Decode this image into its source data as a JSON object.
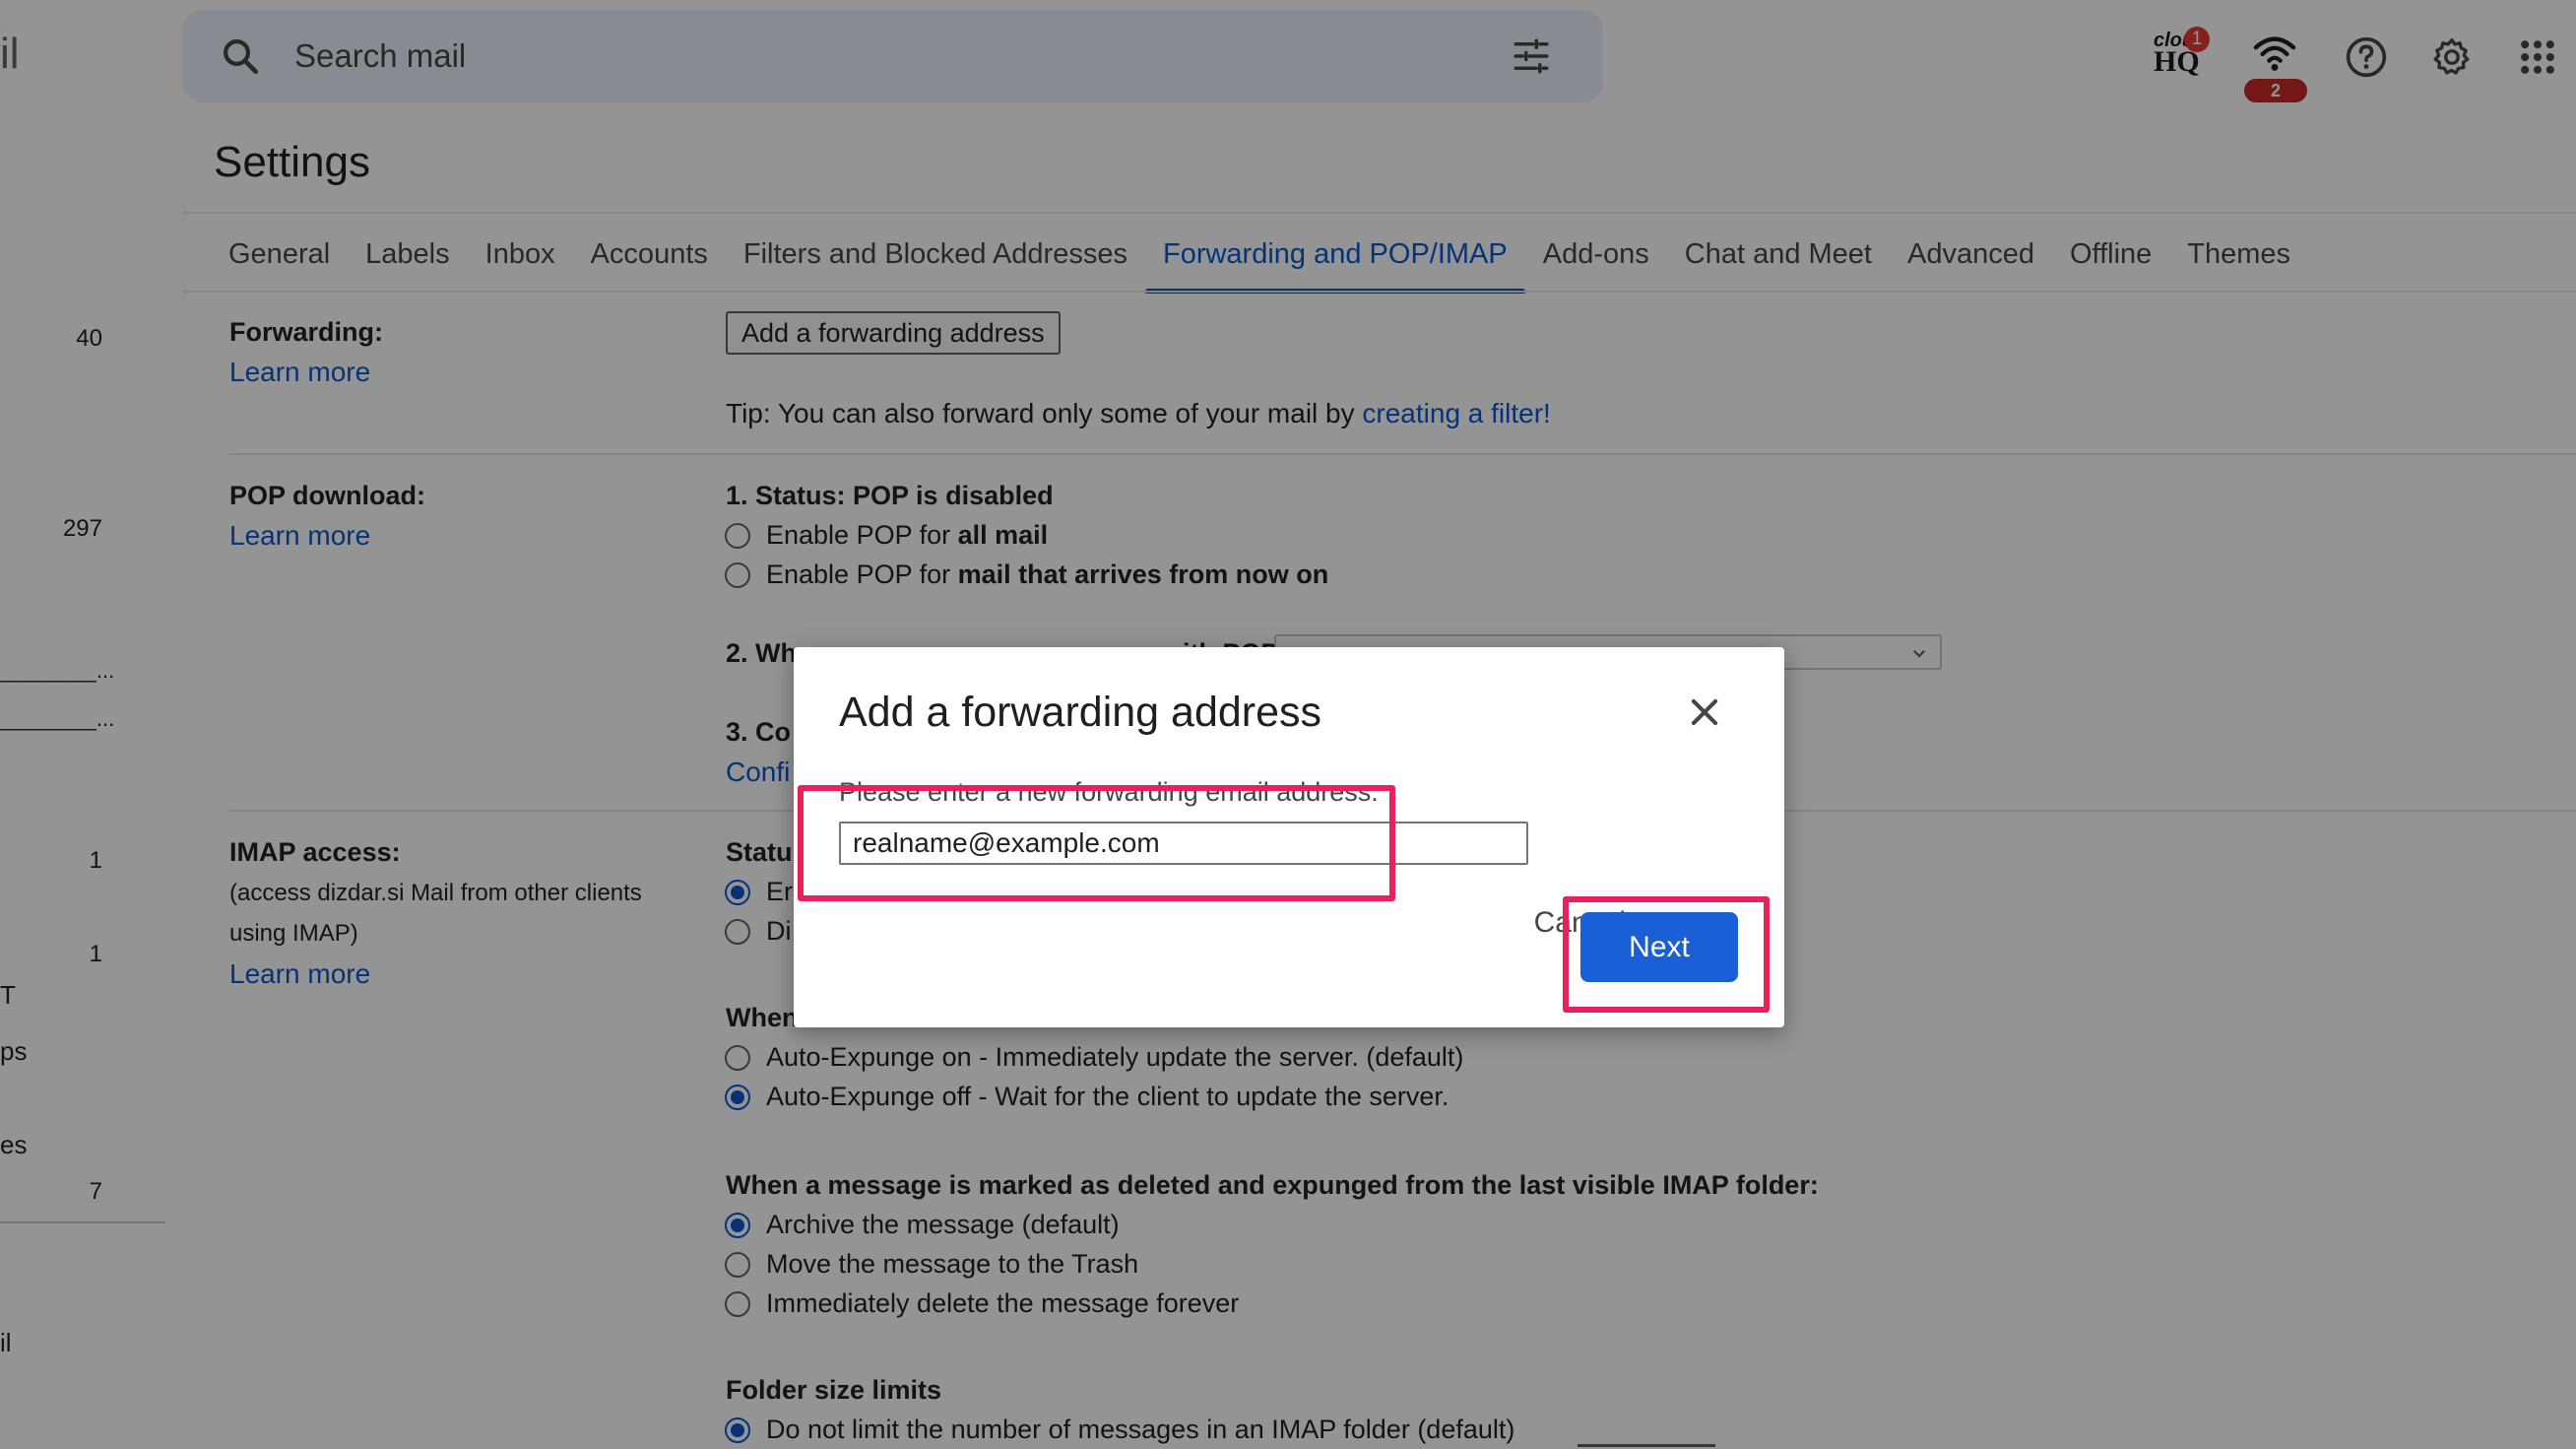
{
  "sidebar": {
    "logo_fragment": "il",
    "counts": [
      "40",
      "297",
      "1",
      "1",
      "7"
    ],
    "fragments": [
      "________...",
      "________...",
      "T",
      "ps",
      "es",
      "il"
    ]
  },
  "topbar": {
    "search_placeholder": "Search mail",
    "search_icon": "search-icon",
    "filter_icon": "tune-icon",
    "cloudhq": {
      "text_top": "clou",
      "text": "HQ",
      "badge": "1"
    },
    "wifi_badge": "2",
    "icons": [
      "help-icon",
      "gear-icon",
      "apps-grid-icon"
    ]
  },
  "settings": {
    "title": "Settings",
    "tabs": [
      {
        "label": "General"
      },
      {
        "label": "Labels"
      },
      {
        "label": "Inbox"
      },
      {
        "label": "Accounts"
      },
      {
        "label": "Filters and Blocked Addresses"
      },
      {
        "label": "Forwarding and POP/IMAP",
        "active": true
      },
      {
        "label": "Add-ons"
      },
      {
        "label": "Chat and Meet"
      },
      {
        "label": "Advanced"
      },
      {
        "label": "Offline"
      },
      {
        "label": "Themes"
      }
    ],
    "forwarding": {
      "label": "Forwarding:",
      "learn_more": "Learn more",
      "button": "Add a forwarding address",
      "tip_prefix": "Tip: You can also forward only some of your mail by ",
      "tip_link": "creating a filter!"
    },
    "pop": {
      "label": "POP download:",
      "learn_more": "Learn more",
      "status": "1. Status: POP is disabled",
      "opt1_prefix": "Enable POP for ",
      "opt1_bold": "all mail",
      "opt2_prefix": "Enable POP for ",
      "opt2_bold": "mail that arrives from now on",
      "step2": "2. Wh",
      "step2_tail": "with POP",
      "step3": "3. Co",
      "config_link": "Confi"
    },
    "imap": {
      "label": "IMAP access:",
      "sub": "(access dizdar.si Mail from other clients using IMAP)",
      "learn_more": "Learn more",
      "status": "Statu",
      "opt_enable": "Er",
      "opt_disable": "Di",
      "when_hdr": "When",
      "expunge_on": "Auto-Expunge on - Immediately update the server. (default)",
      "expunge_off": "Auto-Expunge off - Wait for the client to update the server.",
      "deleted_hdr": "When a message is marked as deleted and expunged from the last visible IMAP folder:",
      "archive": "Archive the message (default)",
      "trash": "Move the message to the Trash",
      "delete_forever": "Immediately delete the message forever",
      "folder_hdr": "Folder size limits",
      "no_limit": "Do not limit the number of messages in an IMAP folder (default)"
    }
  },
  "dialog": {
    "title": "Add a forwarding address",
    "prompt": "Please enter a new forwarding email address:",
    "input_value": "realname@example.com",
    "cancel": "Cancel",
    "next": "Next",
    "accent_color": "#1a5fd6",
    "highlight_color": "#e8215a"
  }
}
